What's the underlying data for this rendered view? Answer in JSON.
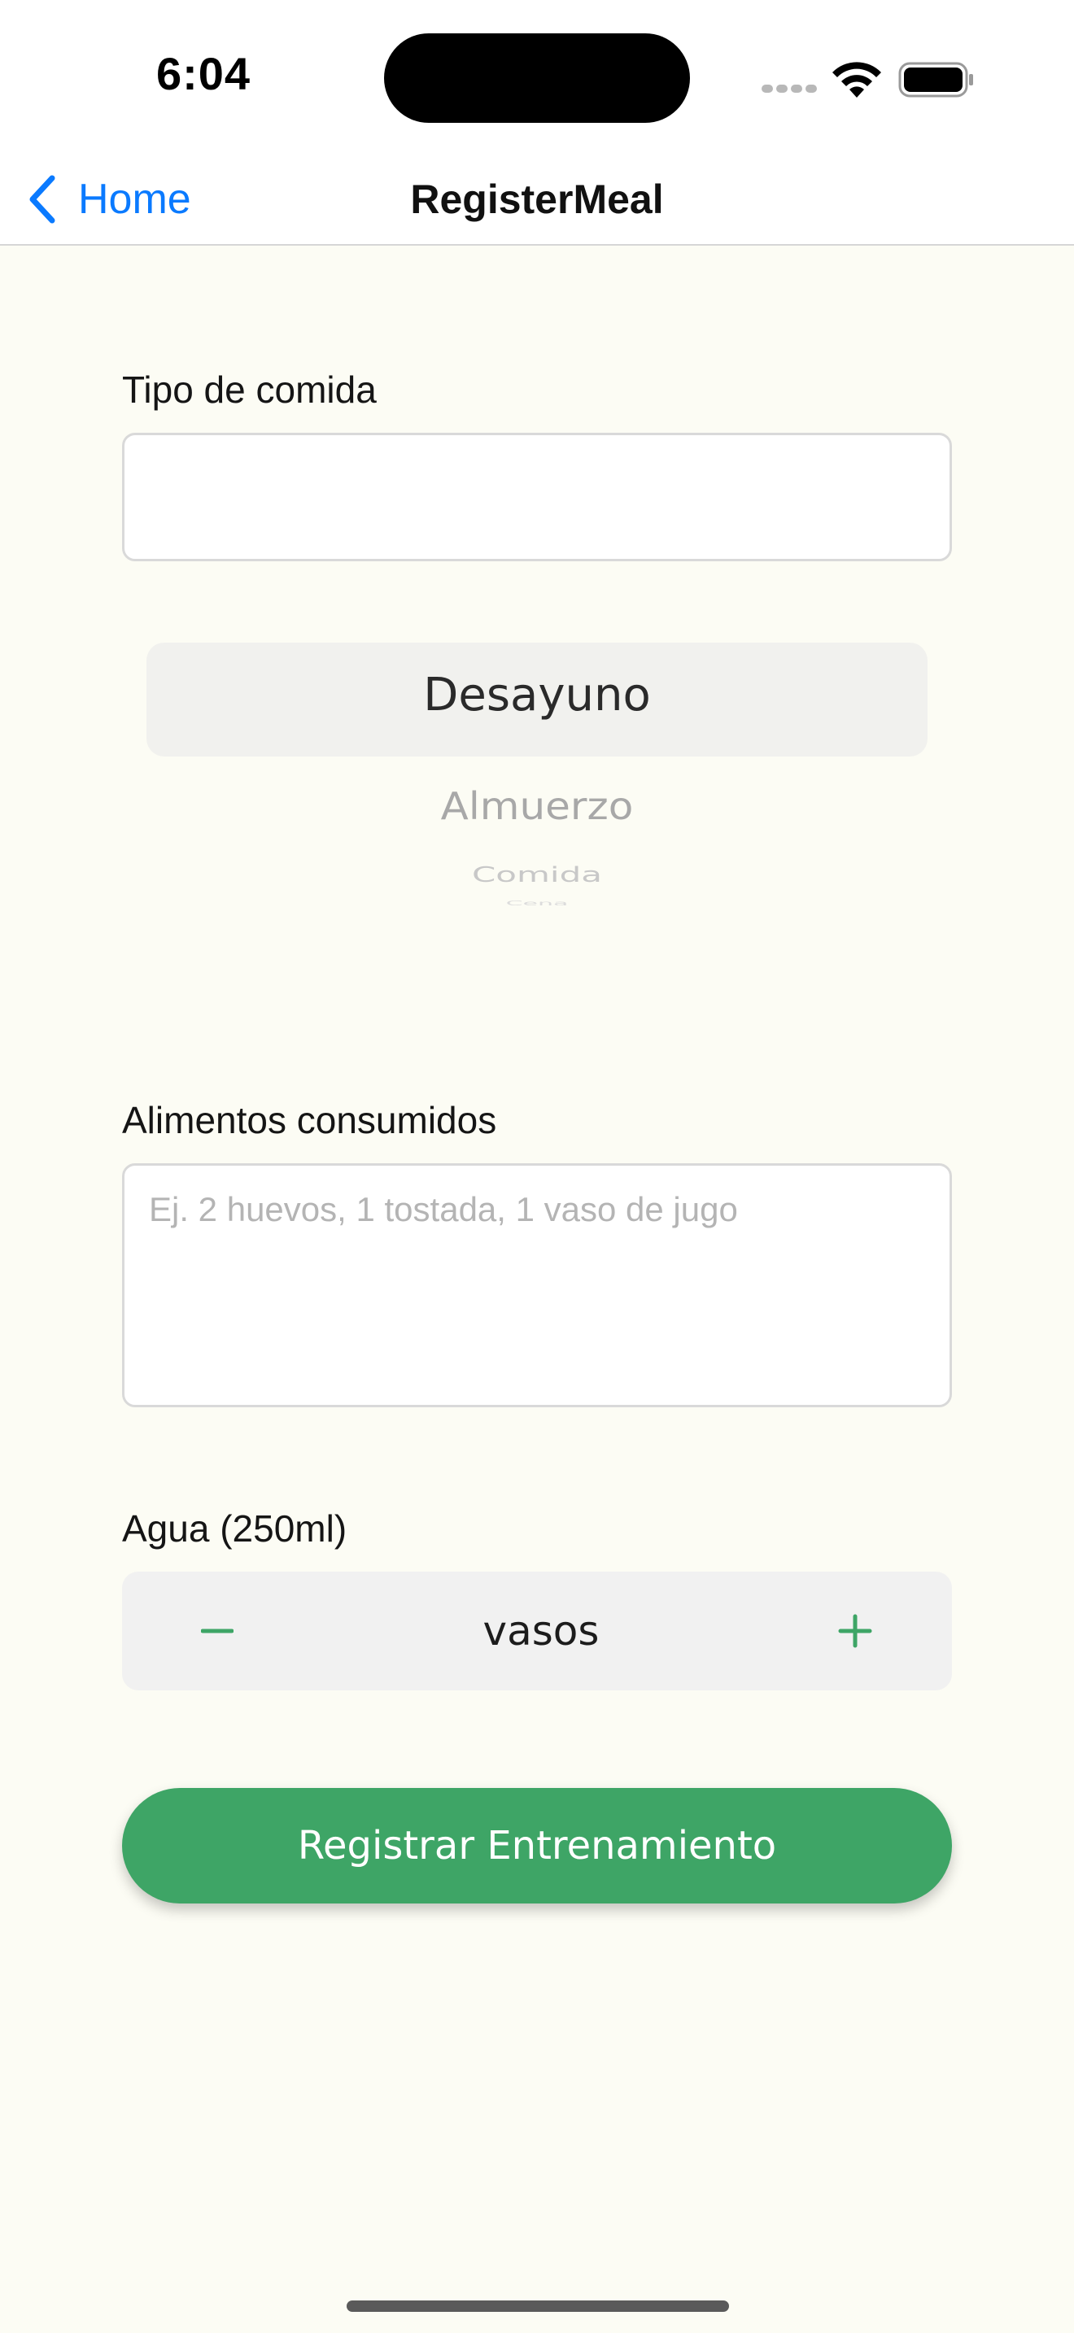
{
  "status_bar": {
    "time": "6:04",
    "icons": [
      "cellular-signal-icon",
      "wifi-icon",
      "battery-icon"
    ]
  },
  "nav": {
    "back_label": "Home",
    "title": "RegisterMeal",
    "back_icon": "chevron-left-icon"
  },
  "form": {
    "meal_type": {
      "label": "Tipo de comida",
      "value": "",
      "placeholder": ""
    },
    "picker": {
      "options": [
        "Desayuno",
        "Almuerzo",
        "Comida",
        "Cena"
      ],
      "selected": "Desayuno"
    },
    "foods": {
      "label": "Alimentos consumidos",
      "value": "",
      "placeholder": "Ej. 2 huevos, 1 tostada, 1 vaso de jugo"
    },
    "water": {
      "label": "Agua (250ml)",
      "value_text": "vasos",
      "minus_symbol": "−",
      "plus_symbol": "+"
    },
    "submit_label": "Registrar Entrenamiento"
  },
  "colors": {
    "background": "#fcfcf4",
    "accent_green": "#3ea566",
    "ios_blue": "#0a7aff",
    "field_border": "#d9d9d9",
    "stepper_bg": "#f1f1f1"
  }
}
